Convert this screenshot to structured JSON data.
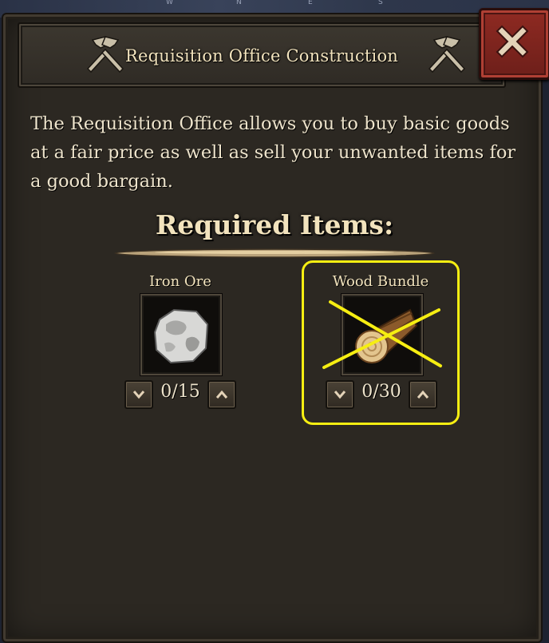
{
  "compass": {
    "w": "W",
    "n": "N",
    "e": "E",
    "s": "S"
  },
  "dialog": {
    "title": "Requisition Office Construction",
    "close_label": "Close",
    "description": "The Requisition Office allows you to buy basic goods at a fair price as well as sell your unwanted items for a good bargain.",
    "required_heading": "Required Items:"
  },
  "items": [
    {
      "name": "Iron Ore",
      "count": "0/15",
      "icon": "iron-ore-icon"
    },
    {
      "name": "Wood Bundle",
      "count": "0/30",
      "icon": "wood-bundle-icon"
    }
  ],
  "colors": {
    "panel": "#2c2822",
    "title_text": "#f2e3bd",
    "close_button": "#8f2a22",
    "annotation": "#f6ee12"
  }
}
